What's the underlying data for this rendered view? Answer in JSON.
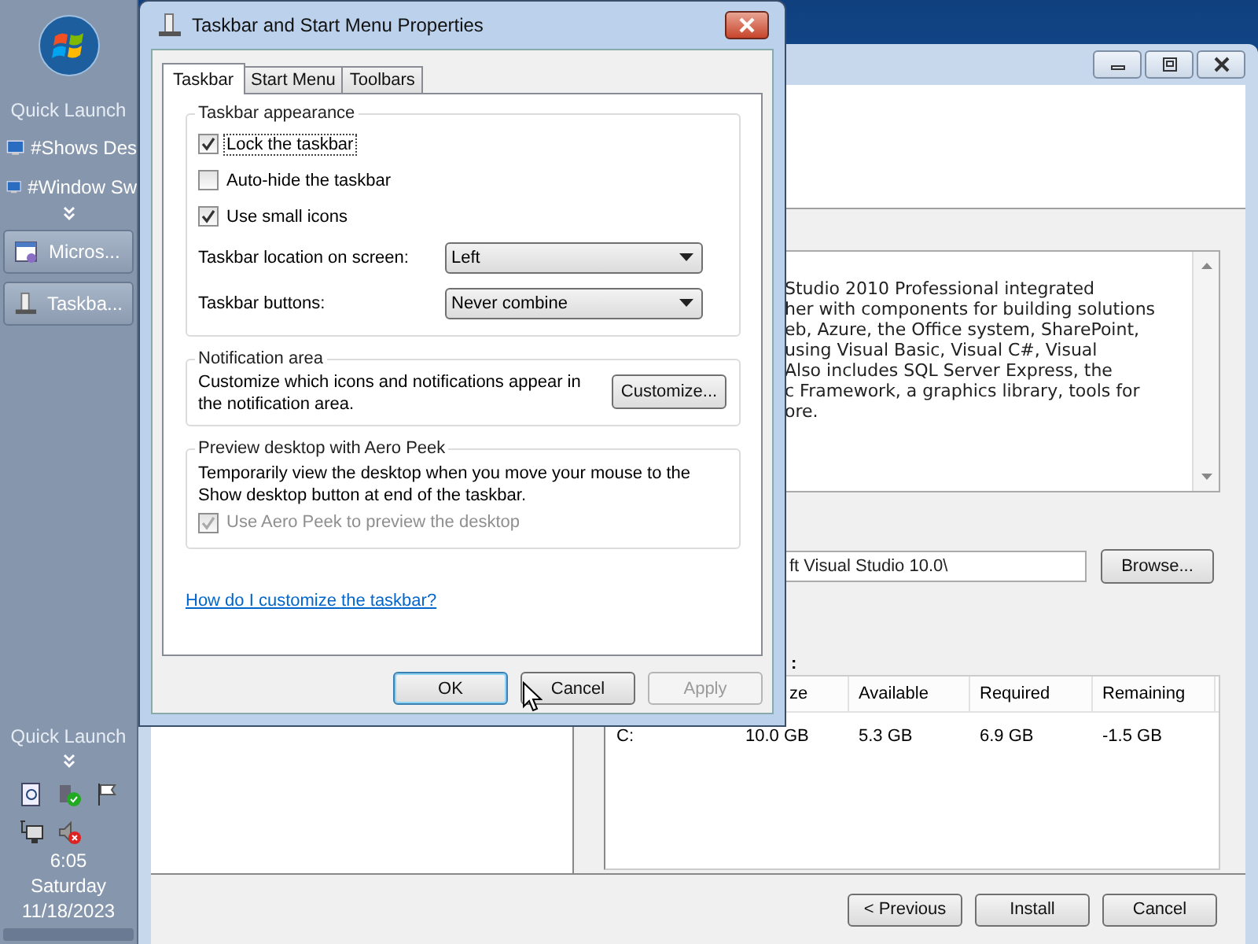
{
  "taskbar": {
    "quick_launch_top": "Quick Launch",
    "quick_launch_items": [
      {
        "label": "#Shows Des"
      },
      {
        "label": "#Window Sw"
      }
    ],
    "tasks": [
      {
        "label": "Micros..."
      },
      {
        "label": "Taskba..."
      }
    ],
    "quick_launch_bottom": "Quick Launch",
    "clock": {
      "time": "6:05",
      "day": "Saturday",
      "date": "11/18/2023"
    }
  },
  "installer": {
    "description_lines": [
      "Studio 2010 Professional integrated",
      "her with components for building solutions",
      "eb, Azure, the Office system, SharePoint,",
      "using Visual Basic, Visual C#, Visual",
      "Also includes SQL Server Express, the",
      "c Framework, a graphics library, tools for",
      "ore."
    ],
    "path_value": "ft Visual Studio 10.0\\",
    "browse": "Browse...",
    "disk_label": ":",
    "columns": [
      "",
      "ze",
      "Available",
      "Required",
      "Remaining"
    ],
    "rows": [
      [
        "C:",
        "10.0 GB",
        "5.3 GB",
        "6.9 GB",
        "-1.5 GB"
      ]
    ],
    "buttons": [
      {
        "label": "< Previous"
      },
      {
        "label": "Install"
      },
      {
        "label": "Cancel"
      }
    ]
  },
  "dialog": {
    "title": "Taskbar and Start Menu Properties",
    "tabs": [
      {
        "label": "Taskbar",
        "selected": true
      },
      {
        "label": "Start Menu",
        "selected": false
      },
      {
        "label": "Toolbars",
        "selected": false
      }
    ],
    "appearance": {
      "title": "Taskbar appearance",
      "options": [
        {
          "label": "Lock the taskbar",
          "checked": true,
          "focused": true
        },
        {
          "label": "Auto-hide the taskbar",
          "checked": false,
          "focused": false
        },
        {
          "label": "Use small icons",
          "checked": true,
          "focused": false
        }
      ],
      "location_label": "Taskbar location on screen:",
      "location_value": "Left",
      "buttons_label": "Taskbar buttons:",
      "buttons_value": "Never combine"
    },
    "notification": {
      "title": "Notification area",
      "text": "Customize which icons and notifications appear in the notification area.",
      "button": "Customize..."
    },
    "peek": {
      "title": "Preview desktop with Aero Peek",
      "text": "Temporarily view the desktop when you move your mouse to the Show desktop button at end of the taskbar.",
      "option": {
        "label": "Use Aero Peek to preview the desktop",
        "checked": true,
        "disabled": true
      }
    },
    "help_link": "How do I customize the taskbar?",
    "buttons": [
      {
        "label": "OK",
        "default": true,
        "disabled": false
      },
      {
        "label": "Cancel",
        "default": false,
        "disabled": false
      },
      {
        "label": "Apply",
        "default": false,
        "disabled": true
      }
    ]
  }
}
